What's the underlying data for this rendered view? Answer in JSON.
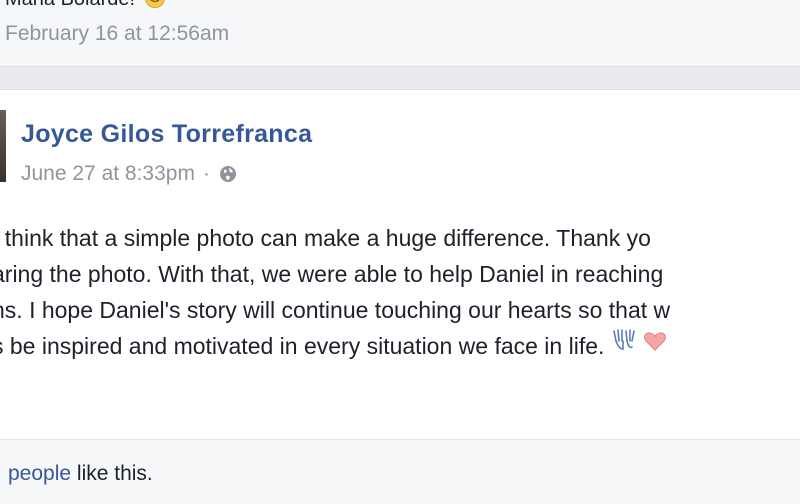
{
  "previous_post": {
    "name_partial": "Maria Bolarde!",
    "timestamp": "February 16 at 12:56am",
    "emoji": "smile-emoji"
  },
  "post": {
    "author": "Joyce Gilos Torrefranca",
    "timestamp": "June 27 at 8:33pm",
    "separator": "·",
    "privacy_icon": "globe-icon",
    "body_lines": [
      "t think that a simple photo can make a huge difference. Thank yo",
      "aring the photo. With that, we were able to help Daniel in reaching",
      "ns. I hope Daniel's story will continue touching our hearts so that w",
      "s be inspired and motivated in every situation we face in life."
    ],
    "trailing_emojis": [
      "raised-hands-emoji",
      "heart-emoji"
    ]
  },
  "likes": {
    "link_text": "people",
    "suffix": " like this."
  },
  "colors": {
    "link_blue": "#365899",
    "meta_gray": "#90949c",
    "text": "#1d2129",
    "page_bg": "#e9ebee"
  }
}
